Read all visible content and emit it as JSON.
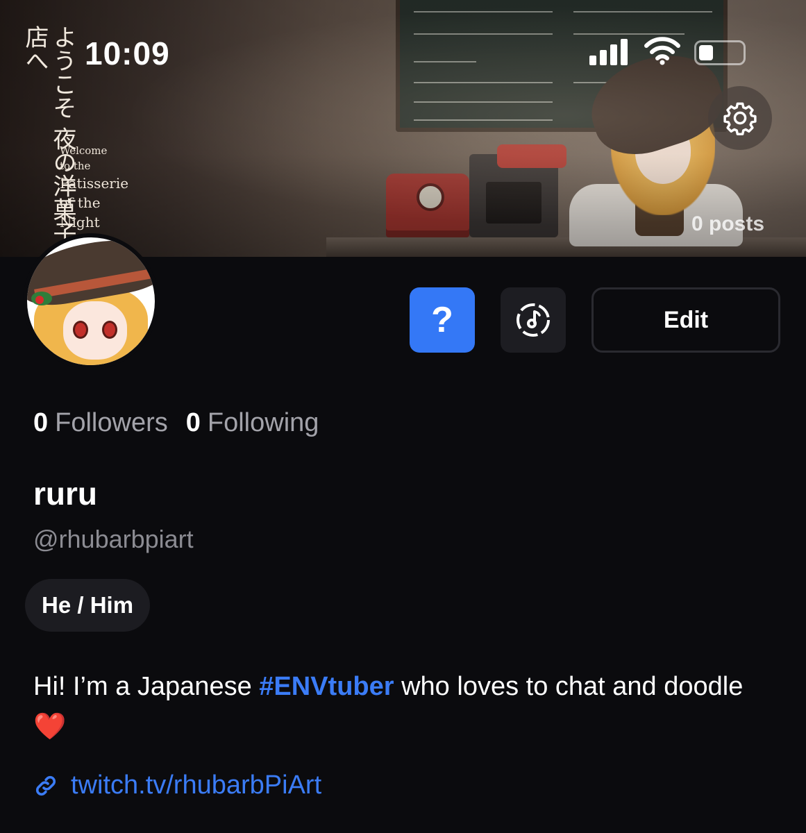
{
  "status_bar": {
    "time": "10:09"
  },
  "banner": {
    "title_jp_line1": "ようこそ",
    "title_jp_line2": "夜の洋菓子店へ",
    "subtitle_line1": "Welcome",
    "subtitle_line2": "to the",
    "subtitle_line3": "Patisserie",
    "subtitle_line4": "of the Night",
    "posts_label": "0 posts"
  },
  "actions": {
    "help_label": "?",
    "edit_label": "Edit"
  },
  "profile": {
    "followers_count": "0",
    "followers_label": "Followers",
    "following_count": "0",
    "following_label": "Following",
    "display_name": "ruru",
    "handle": "@rhubarbpiart",
    "pronouns": "He / Him",
    "bio_before": "Hi! I’m a Japanese ",
    "bio_hashtag": "#ENVtuber",
    "bio_after": " who loves to chat and doodle ",
    "bio_emoji": "❤️",
    "link": "twitch.tv/rhubarbPiArt"
  },
  "colors": {
    "background": "#0b0b0e",
    "accent_blue": "#3478f6",
    "muted_text": "#8c8c93",
    "button_dark": "#1d1d22"
  },
  "icons": [
    "signal-icon",
    "wifi-icon",
    "battery-icon",
    "gear-icon",
    "question-icon",
    "music-disc-icon",
    "link-icon"
  ]
}
